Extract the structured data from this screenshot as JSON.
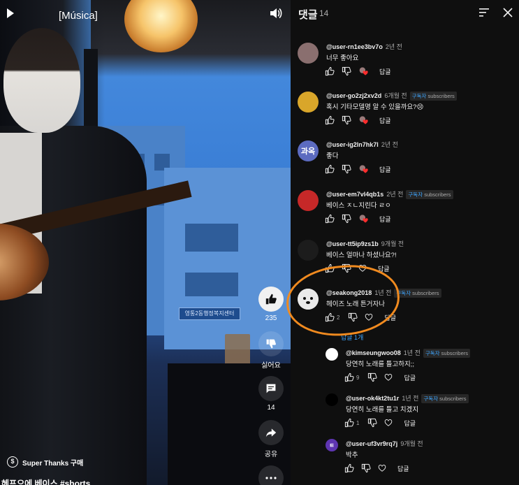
{
  "video": {
    "title": "[Música]",
    "sign_text": "영통2동행정복지센터",
    "actions": {
      "like_count": "235",
      "dislike_label": "싫어요",
      "comment_count": "14",
      "share_label": "공유"
    },
    "super_thanks_label": "Super Thanks 구매",
    "caption": "헤프으에 베이스 #shorts"
  },
  "comments_panel": {
    "title": "댓글",
    "count": "14",
    "reply_label": "답글",
    "subscriber_badge_ko": "구독자",
    "subscriber_badge_en": "subscribers",
    "replies_toggle": "답글 1개",
    "comments": [
      {
        "author": "@user-rn1ee3bv7o",
        "time": "2년 전",
        "text": "너무 좋아요",
        "subscriber": false,
        "avatar_text": "",
        "avatar_color": "#8a6f6f"
      },
      {
        "author": "@user-go2zj2xv2d",
        "time": "6개월 전",
        "text": "혹시 기타모델명 알 수 있을까요?😢",
        "subscriber": true,
        "avatar_text": "",
        "avatar_color": "#d9a62a"
      },
      {
        "author": "@user-ig2ln7hk7l",
        "time": "2년 전",
        "text": "좋다",
        "subscriber": false,
        "avatar_text": "과옥",
        "avatar_color": "#5c6bc0"
      },
      {
        "author": "@user-em7vl4qb1s",
        "time": "2년 전",
        "text": "베이스 ㅈㄴ지린다 ㄹㅇ",
        "subscriber": true,
        "avatar_text": "",
        "avatar_color": "#c62828"
      },
      {
        "author": "@user-tt5ip9zs1b",
        "time": "9개월 전",
        "text": "베이스 얼마나 하셨나요?!",
        "subscriber": false,
        "avatar_text": "",
        "avatar_color": "#1c1c1c"
      },
      {
        "author": "@seakong2018",
        "time": "1년 전",
        "text": "헤이즈   노래 튼거자나",
        "subscriber": true,
        "avatar_text": "",
        "avatar_color": "#f2f2f2",
        "likes": "2"
      }
    ],
    "replies": [
      {
        "author": "@kimseungwoo08",
        "time": "1년 전",
        "text": "당연히 노래를 틀고하지;;",
        "subscriber": true,
        "avatar_text": "",
        "avatar_color": "#ffffff",
        "likes": "9"
      },
      {
        "author": "@user-ok4kt2tu1r",
        "time": "1년 전",
        "text": "당연히 노래를 틀고 치겠지",
        "subscriber": true,
        "avatar_text": "",
        "avatar_color": "#000000",
        "likes": "1"
      },
      {
        "author": "@user-uf3vr9rq7j",
        "time": "9개월 전",
        "text": "박추",
        "subscriber": false,
        "avatar_text": "ㅌ",
        "avatar_color": "#5e35b1",
        "likes": ""
      }
    ]
  },
  "colors": {
    "accent_link": "#3ea6ff",
    "highlight_ring": "#f08a1f",
    "panel_bg": "#0f0f0f"
  }
}
